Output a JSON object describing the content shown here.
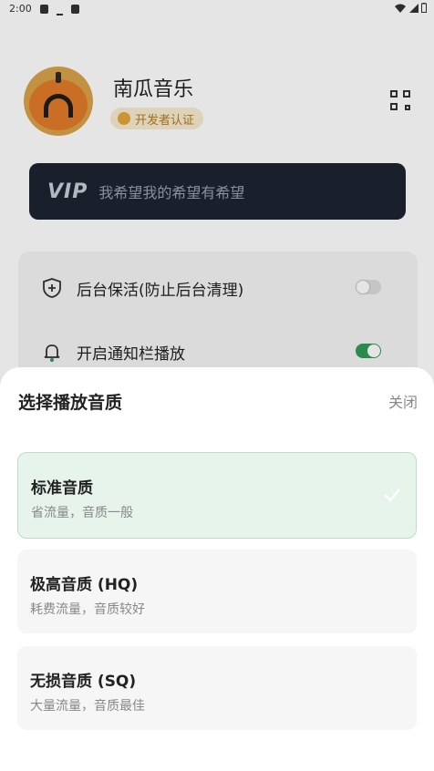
{
  "status_bar": {
    "time": "2:00"
  },
  "profile": {
    "app_name": "南瓜音乐",
    "badge": "开发者认证"
  },
  "vip": {
    "logo": "VIP",
    "slogan": "我希望我的希望有希望"
  },
  "settings": [
    {
      "label": "后台保活(防止后台清理)",
      "icon": "shield-plus-icon",
      "enabled": false
    },
    {
      "label": "开启通知栏播放",
      "icon": "bell-icon",
      "enabled": true
    }
  ],
  "colors": {
    "accent": "#2e9b5a",
    "sheet_selected": "#e6f4ec",
    "vip_bar": "#1e2331"
  },
  "sheet": {
    "title": "选择播放音质",
    "close": "关闭",
    "options": [
      {
        "name": "标准音质",
        "desc": "省流量，音质一般",
        "selected": true
      },
      {
        "name": "极高音质 (HQ)",
        "desc": "耗费流量，音质较好",
        "selected": false
      },
      {
        "name": "无损音质 (SQ)",
        "desc": "大量流量，音质最佳",
        "selected": false
      }
    ]
  }
}
